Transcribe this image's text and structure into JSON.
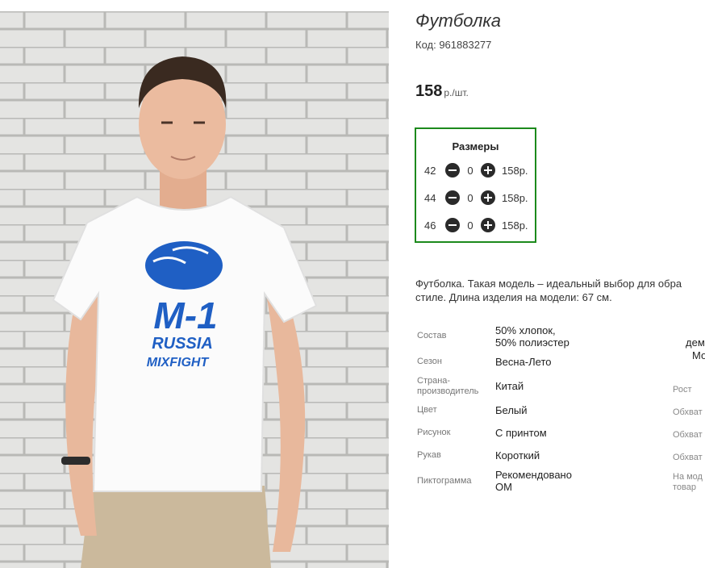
{
  "product": {
    "title": "Футболка",
    "code": "Код: 961883277",
    "price_value": "158",
    "price_unit": "р./шт."
  },
  "sizes": {
    "header": "Размеры",
    "rows": [
      {
        "size": "42",
        "qty": "0",
        "price": "158р."
      },
      {
        "size": "44",
        "qty": "0",
        "price": "158р."
      },
      {
        "size": "46",
        "qty": "0",
        "price": "158р."
      }
    ]
  },
  "description": {
    "line1": "Футболка. Такая модель – идеальный выбор для обра",
    "line2": "стиле. Длина изделия на модели: 67 см."
  },
  "attributes": [
    {
      "label": "Состав",
      "value1": "50% хлопок,",
      "value2": "50% полиэстер"
    },
    {
      "label": "Сезон",
      "value1": "Весна-Лето"
    },
    {
      "label1": "Страна-",
      "label2": "производитель",
      "value1": "Китай"
    },
    {
      "label": "Цвет",
      "value1": "Белый"
    },
    {
      "label": "Рисунок",
      "value1": "С принтом"
    },
    {
      "label": "Рукав",
      "value1": "Короткий"
    },
    {
      "label": "Пиктограмма",
      "value1": "Рекомендовано",
      "value2": "ОМ"
    }
  ],
  "right_column": {
    "frag1": "дем",
    "frag2": "Мо",
    "rost": "Рост",
    "obhvat1": "Обхват",
    "obhvat2": "Обхват",
    "obhvat3": "Обхват",
    "na_mod1": "На мод",
    "na_mod2": "товар"
  },
  "print": {
    "logo_main": "M-1",
    "logo_line2": "RUSSIA",
    "logo_line3": "MIXFIGHT"
  },
  "colors": {
    "sizes_border": "#1c8a1c",
    "print_blue": "#1f5fc4"
  }
}
